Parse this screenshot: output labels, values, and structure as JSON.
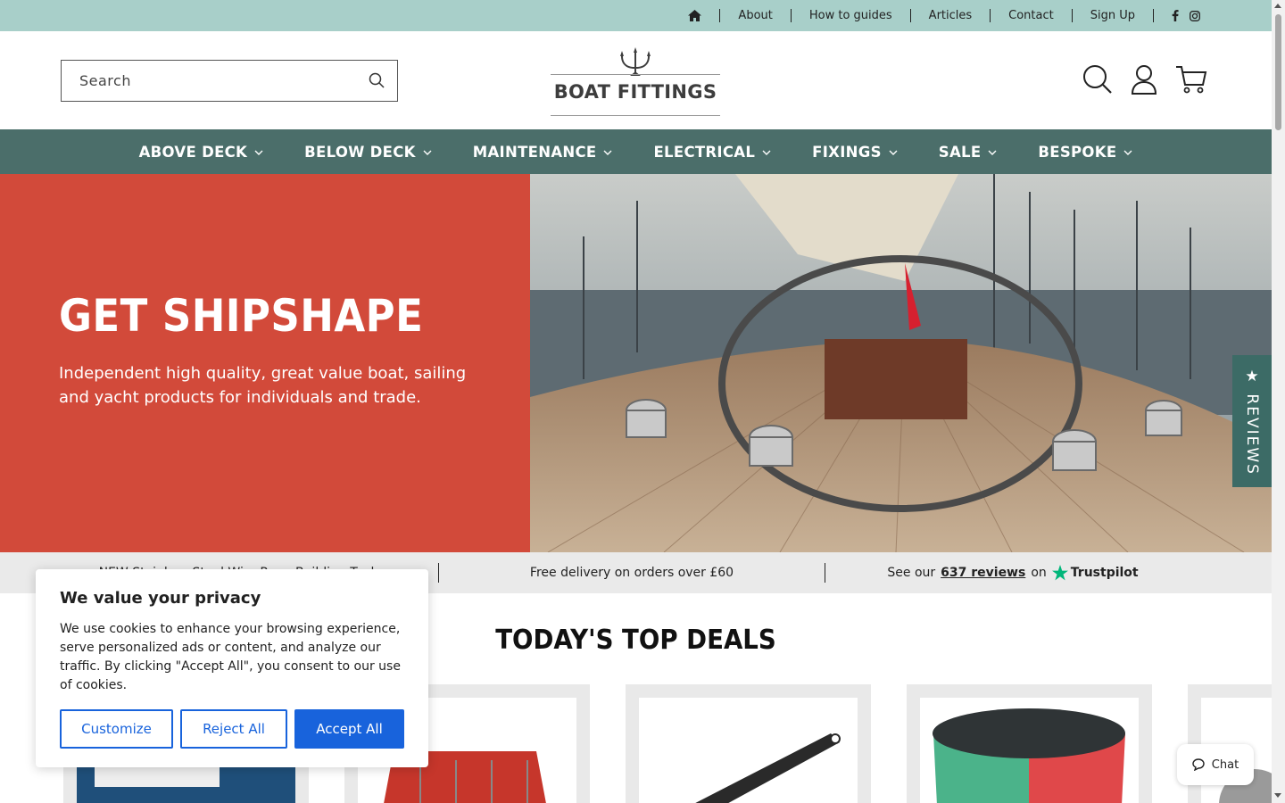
{
  "topbar": {
    "links": [
      "About",
      "How to guides",
      "Articles",
      "Contact",
      "Sign Up"
    ]
  },
  "header": {
    "search_placeholder": "Search",
    "logo_text": "BOAT FITTINGS"
  },
  "nav": {
    "items": [
      "ABOVE DECK",
      "BELOW DECK",
      "MAINTENANCE",
      "ELECTRICAL",
      "FIXINGS",
      "SALE",
      "BESPOKE"
    ]
  },
  "hero": {
    "title": "GET SHIPSHAPE",
    "subtitle": "Independent high quality, great value boat, sailing and yacht products for individuals and trade."
  },
  "reviews_tab": "★ REVIEWS",
  "infostrip": {
    "left": "NEW Stainless Steel Wire Rope Building Tool",
    "middle": "Free delivery on orders over £60",
    "right_prefix": "See our",
    "right_link": "637 reviews",
    "right_suffix": "on",
    "trustpilot": "Trustpilot"
  },
  "deals": {
    "title": "TODAY'S TOP DEALS"
  },
  "cookie": {
    "title": "We value your privacy",
    "body": "We use cookies to enhance your browsing experience, serve personalized ads or content, and analyze our traffic. By clicking \"Accept All\", you consent to our use of cookies.",
    "customize": "Customize",
    "reject": "Reject All",
    "accept": "Accept All"
  },
  "chat": {
    "label": "Chat"
  },
  "colors": {
    "topbar": "#a8cfc9",
    "nav": "#4b6e6a",
    "hero_red": "#d24a3a",
    "cookie_blue": "#1863dc",
    "trustpilot_green": "#00b67a"
  },
  "icons": [
    "home-icon",
    "facebook-icon",
    "instagram-icon",
    "search-icon",
    "account-icon",
    "cart-icon",
    "chevron-down-icon",
    "chat-icon",
    "trustpilot-star-icon"
  ]
}
